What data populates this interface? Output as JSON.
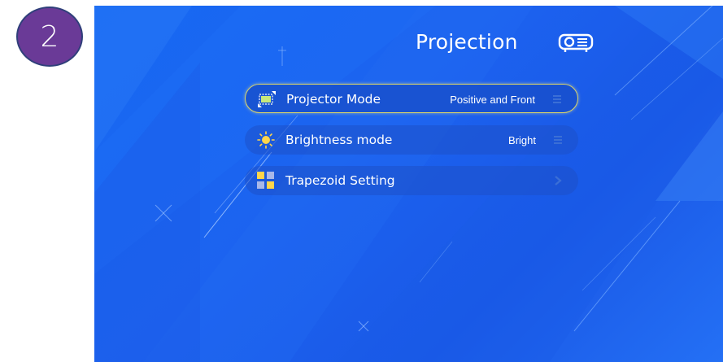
{
  "step_number": "2",
  "header": {
    "title": "Projection",
    "icon": "projector-icon"
  },
  "menu": {
    "items": [
      {
        "icon": "projector-mode-icon",
        "label": "Projector Mode",
        "value": "Positive and Front",
        "trail_icon": "list-icon",
        "focused": true
      },
      {
        "icon": "sun-icon",
        "label": "Brightness mode",
        "value": "Bright",
        "trail_icon": "list-icon",
        "focused": false
      },
      {
        "icon": "tiles-icon",
        "label": "Trapezoid Setting",
        "value": "",
        "trail_icon": "chevron-right-icon",
        "focused": false
      }
    ]
  },
  "colors": {
    "background": "#1c63f0",
    "focus_border": "#d9d46a",
    "badge": "#6a3a97",
    "icon_yellow": "#ffd54a"
  }
}
